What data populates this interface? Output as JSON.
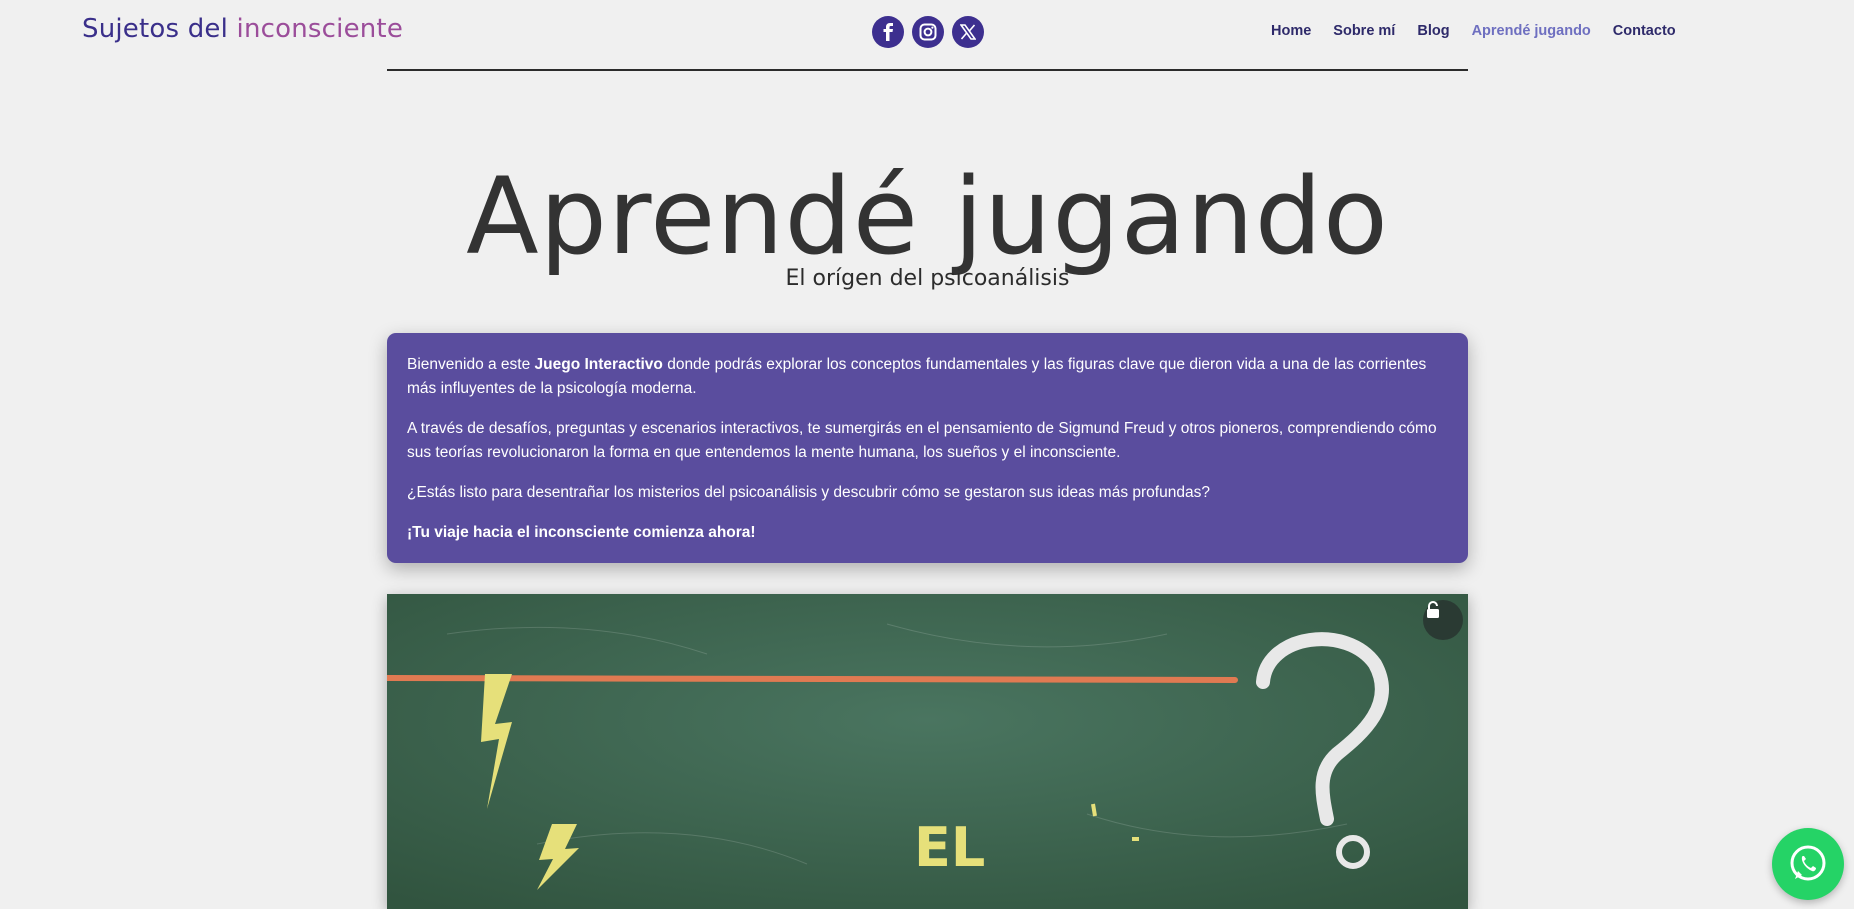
{
  "header": {
    "logo_part1": "Sujetos del ",
    "logo_part2": "inconsciente",
    "social": [
      {
        "icon": "facebook-icon"
      },
      {
        "icon": "instagram-icon"
      },
      {
        "icon": "x-twitter-icon"
      }
    ],
    "nav": [
      {
        "label": "Home"
      },
      {
        "label": "Sobre mí"
      },
      {
        "label": "Blog"
      },
      {
        "label": "Aprendé jugando"
      },
      {
        "label": "Contacto"
      }
    ],
    "active_nav": "Aprendé jugando"
  },
  "main": {
    "title": "Aprendé jugando",
    "subtitle": "El orígen del psicoanálisis",
    "intro": {
      "p1_a": "Bienvenido a este ",
      "p1_bold": "Juego Interactivo",
      "p1_b": " donde podrás explorar los conceptos fundamentales y las figuras clave que dieron vida a una de las corrientes más influyentes de la psicología moderna.",
      "p2": "A través de desafíos, preguntas y escenarios interactivos, te sumergirás en el pensamiento de Sigmund Freud y otros pioneros, comprendiendo cómo sus teorías revolucionaron la forma en que entendemos la mente humana, los sueños y el inconsciente.",
      "p3": "¿Estás listo para desentrañar los misterios del psicoanálisis y descubrir cómo se gestaron sus ideas más profundas?",
      "p4": "¡Tu viaje hacia el inconsciente comienza ahora!"
    },
    "game": {
      "chalk_text": "EL",
      "unlock_icon": "unlock-icon"
    }
  },
  "floating": {
    "icon": "whatsapp-icon"
  },
  "colors": {
    "background": "#f0f0f0",
    "logo_primary": "#3a2f8a",
    "logo_accent": "#9b4d9a",
    "card": "#5a4d9e",
    "nav_active": "#6e6fc0",
    "chalkboard": "#3f6650",
    "whatsapp": "#25d366"
  }
}
